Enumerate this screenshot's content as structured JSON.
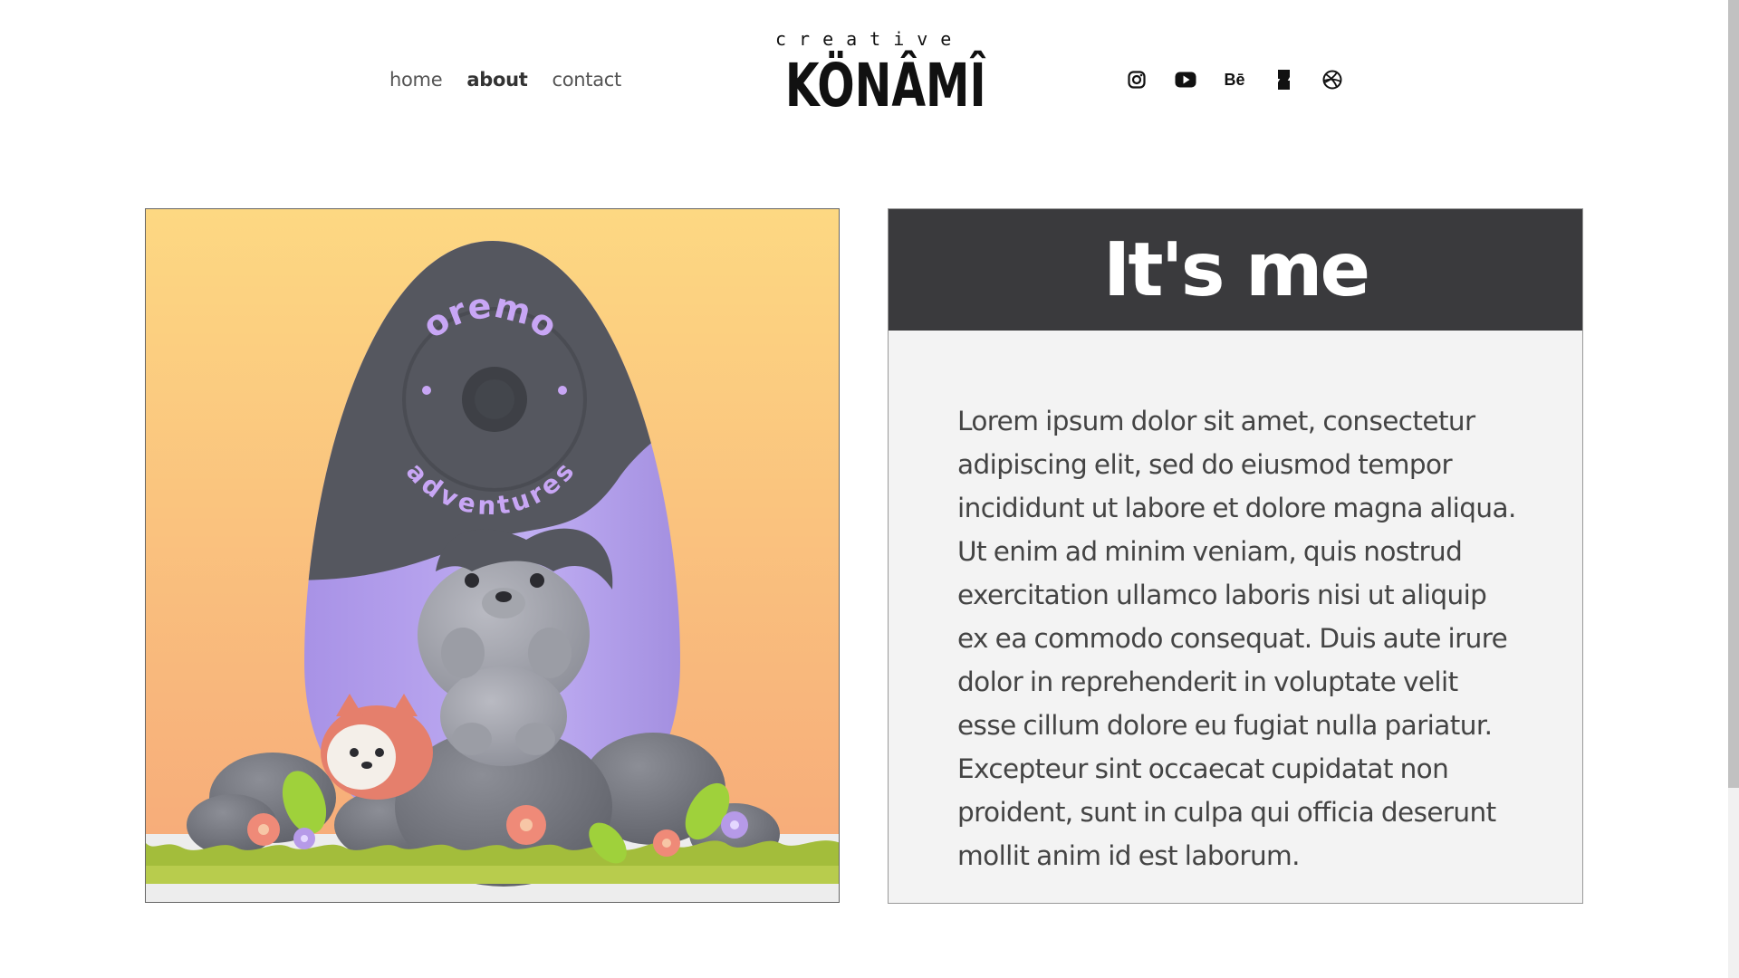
{
  "nav": {
    "items": [
      {
        "label": "home",
        "active": false
      },
      {
        "label": "about",
        "active": true
      },
      {
        "label": "contact",
        "active": false
      }
    ]
  },
  "logo": {
    "top_text": "creative",
    "main_text": "KÖNÂMÎ"
  },
  "social": [
    "instagram-icon",
    "youtube-icon",
    "behance-icon",
    "deviantart-icon",
    "dribbble-icon"
  ],
  "social_labels": {
    "behance": "Bē"
  },
  "illustration": {
    "badge_top": "oremo",
    "badge_bottom": "adventures"
  },
  "about": {
    "heading": "It's me",
    "body": "Lorem ipsum dolor sit amet, consectetur adipiscing elit, sed do eiusmod tempor incididunt ut labore et dolore magna aliqua. Ut enim ad minim veniam, quis nostrud exercitation ullamco laboris nisi ut aliquip ex ea commodo consequat. Duis aute irure dolor in reprehenderit in voluptate velit esse cillum dolore eu fugiat nulla pariatur. Excepteur sint occaecat cupidatat non proident, sunt in culpa qui officia deserunt mollit anim id est laborum."
  },
  "colors": {
    "heading_bg": "#3a3a3d",
    "panel_bg": "#f3f3f3",
    "sky_top": "#fdd882",
    "sky_bottom": "#f6a879",
    "egg_purple": "#b7a3ee",
    "egg_dark": "#55575f",
    "badge_text": "#c8a6f5"
  }
}
